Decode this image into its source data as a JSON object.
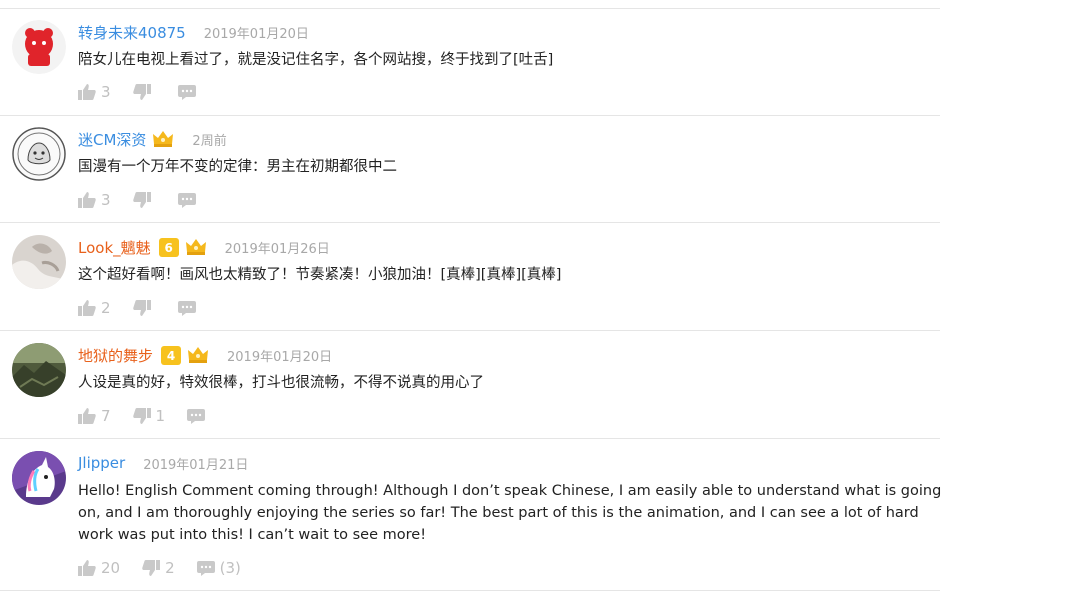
{
  "comments": [
    {
      "username": "转身未来40875",
      "name_color": "blue",
      "time": "2019年01月20日",
      "text": "陪女儿在电视上看过了，就是没记住名字，各个网站搜，终于找到了[吐舌]",
      "likes": "3",
      "dislikes": "",
      "replies": ""
    },
    {
      "username": "迷CM深资",
      "name_color": "blue",
      "time": "2周前",
      "text": "国漫有一个万年不变的定律：男主在初期都很中二",
      "likes": "3",
      "dislikes": "",
      "replies": ""
    },
    {
      "username": "Look_魑魅",
      "name_color": "orange",
      "level": "6",
      "time": "2019年01月26日",
      "text": "这个超好看啊！画风也太精致了！节奏紧凑！小狼加油！[真棒][真棒][真棒]",
      "likes": "2",
      "dislikes": "",
      "replies": ""
    },
    {
      "username": "地狱的舞步",
      "name_color": "orange",
      "level": "4",
      "time": "2019年01月20日",
      "text": "人设是真的好，特效很棒，打斗也很流畅，不得不说真的用心了",
      "likes": "7",
      "dislikes": "1",
      "replies": ""
    },
    {
      "username": "Jlipper",
      "name_color": "blue",
      "time": "2019年01月21日",
      "text": "Hello! English Comment coming through! Although I don’t speak Chinese, I am easily able to understand what is going on, and I am thoroughly enjoying the series so far! The best part of this is the animation, and I can see a lot of hard work was put into this! I can’t wait to see more!",
      "likes": "20",
      "dislikes": "2",
      "replies": "(3)"
    }
  ],
  "icons": {
    "like": "thumbs-up-icon",
    "dislike": "thumbs-down-icon",
    "reply": "comment-icon",
    "crown": "crown-icon"
  }
}
